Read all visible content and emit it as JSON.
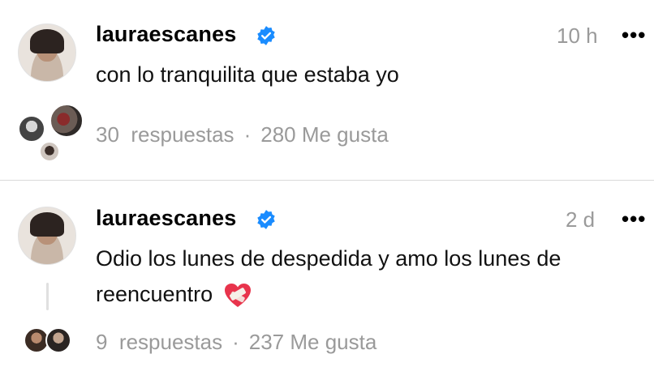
{
  "posts": [
    {
      "username": "lauraescanes",
      "time": "10 h",
      "more": "•••",
      "text": "con lo tranquilita que estaba yo",
      "replies": "30  respuestas",
      "separator": "·",
      "likes": "280 Me gusta"
    },
    {
      "username": "lauraescanes",
      "time": "2 d",
      "more": "•••",
      "text": "Odio los lunes de despedida y amo los lunes de reencuentro",
      "replies": "9  respuestas",
      "separator": "·",
      "likes": "237 Me gusta"
    }
  ],
  "colors": {
    "verified": "#1a8cff",
    "muted": "#9a9a9a",
    "heart": "#e8344c"
  },
  "icons": {
    "verified": "verified-badge-icon",
    "more": "more-options-icon",
    "heart": "mending-heart-emoji"
  }
}
